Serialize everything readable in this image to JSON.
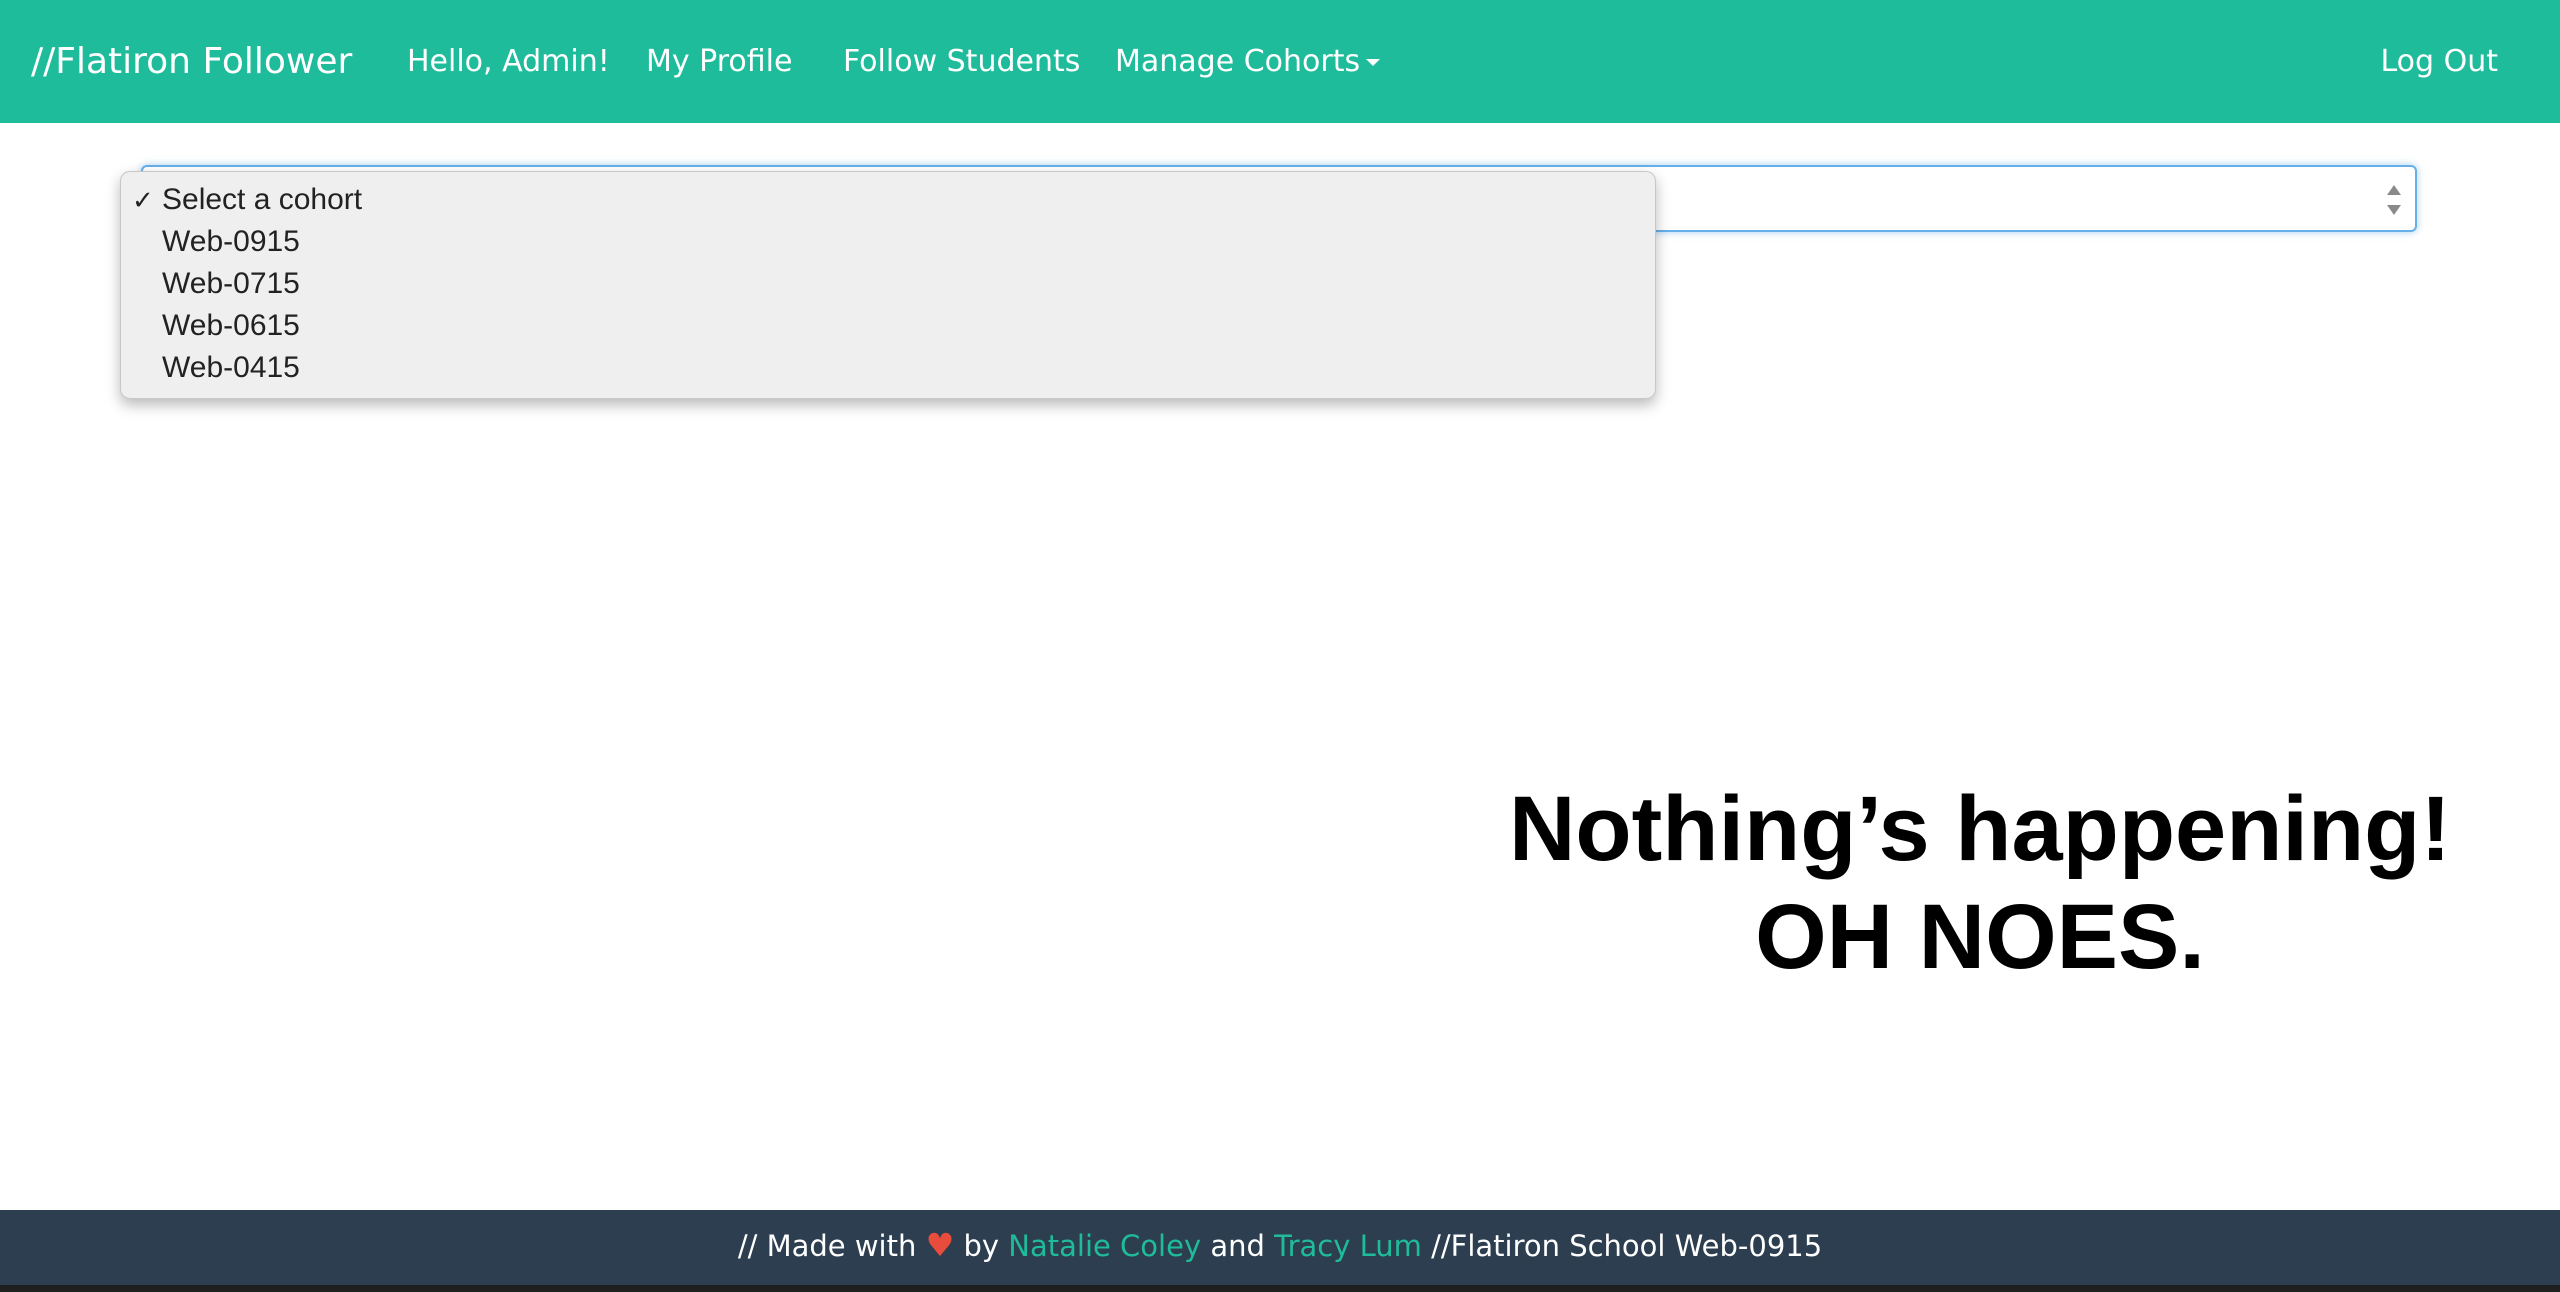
{
  "navbar": {
    "brand": "//Flatiron Follower",
    "greeting": "Hello, Admin!",
    "profile": "My Profile",
    "follow_students": "Follow Students",
    "manage_cohorts": "Manage Cohorts",
    "logout": "Log Out",
    "background_color": "#1fbc9c"
  },
  "cohort_select": {
    "selected": "Select a cohort",
    "options": [
      {
        "label": "Select a cohort",
        "checked": true
      },
      {
        "label": "Web-0915"
      },
      {
        "label": "Web-0715"
      },
      {
        "label": "Web-0615"
      },
      {
        "label": "Web-0415"
      }
    ]
  },
  "empty_state": {
    "line1": "Nothing’s happening!",
    "line2": "OH NOES."
  },
  "footer": {
    "prefix": "// Made with",
    "heart_icon": "heart-icon",
    "by": "by",
    "author1": "Natalie Coley",
    "and": "and",
    "author2": "Tracy Lum",
    "suffix": "//Flatiron School Web-0915",
    "background_color": "#2c3e50",
    "link_color": "#1fbc9c"
  }
}
